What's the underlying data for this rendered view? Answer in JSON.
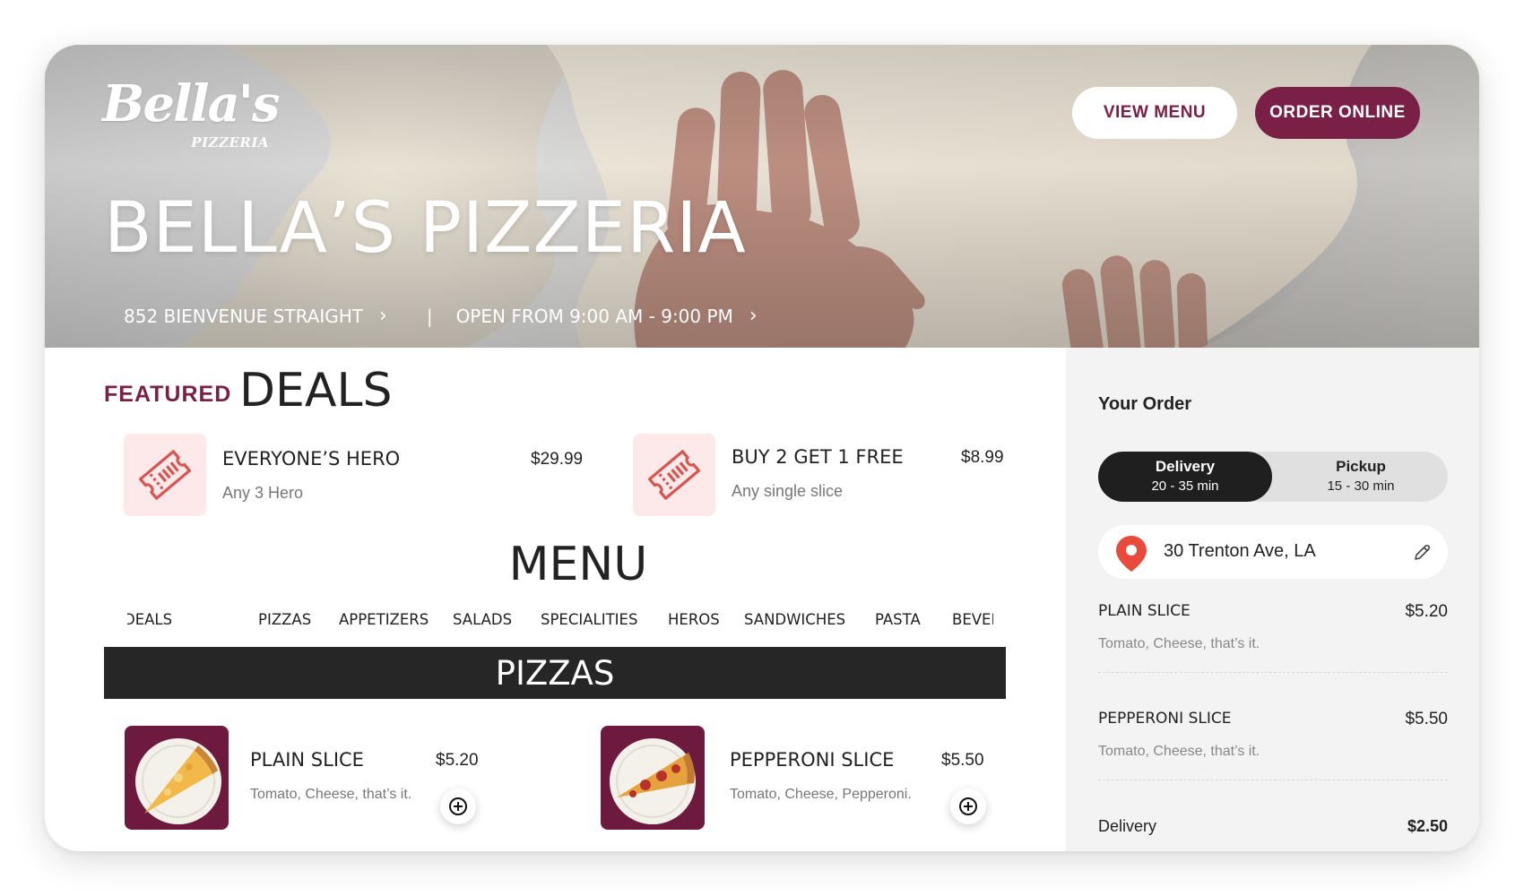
{
  "colors": {
    "brand": "#7a1f45",
    "dark": "#262626",
    "pin": "#e84a3c",
    "deal_thumb_bg": "#fde9e9"
  },
  "header": {
    "logo_text": "Bella's",
    "logo_subtext": "PIZZERIA",
    "view_menu_label": "VIEW MENU",
    "order_online_label": "ORDER ONLINE",
    "title": "BELLA’S PIZZERIA",
    "address": "852 BIENVENUE STRAIGHT",
    "separator": "|",
    "hours": "OPEN FROM 9:00 AM - 9:00 PM",
    "chevron": "›"
  },
  "deals": {
    "featured_label": "FEATURED",
    "title": "DEALS",
    "items": [
      {
        "name": "EVERYONE’S HERO",
        "subtitle": "Any 3 Hero",
        "price": "$29.99",
        "icon": "ticket-icon"
      },
      {
        "name": "BUY 2 GET 1 FREE",
        "subtitle": "Any single slice",
        "price": "$8.99",
        "icon": "ticket-icon"
      }
    ]
  },
  "menu": {
    "title": "MENU",
    "categories": [
      "DEALS",
      "PIZZAS",
      "APPETIZERS",
      "SALADS",
      "SPECIALITIES",
      "HEROS",
      "SANDWICHES",
      "PASTA",
      "BEVERAGES"
    ],
    "section_title": "PIZZAS",
    "items": [
      {
        "name": "PLAIN SLICE",
        "description": "Tomato, Cheese, that’s it.",
        "price": "$5.20",
        "icon": "plus-circle-icon"
      },
      {
        "name": "PEPPERONI SLICE",
        "description": "Tomato, Cheese, Pepperoni.",
        "price": "$5.50",
        "icon": "plus-circle-icon"
      }
    ]
  },
  "order": {
    "title": "Your Order",
    "delivery": {
      "label": "Delivery",
      "time": "20 - 35 min",
      "selected": true
    },
    "pickup": {
      "label": "Pickup",
      "time": "15 - 30 min",
      "selected": false
    },
    "address": "30 Trenton Ave, LA",
    "items": [
      {
        "name": "PLAIN SLICE",
        "price": "$5.20",
        "description": "Tomato, Cheese, that’s it."
      },
      {
        "name": "PEPPERONI SLICE",
        "price": "$5.50",
        "description": "Tomato, Cheese, that’s it."
      }
    ],
    "delivery_fee_label": "Delivery",
    "delivery_fee": "$2.50"
  }
}
